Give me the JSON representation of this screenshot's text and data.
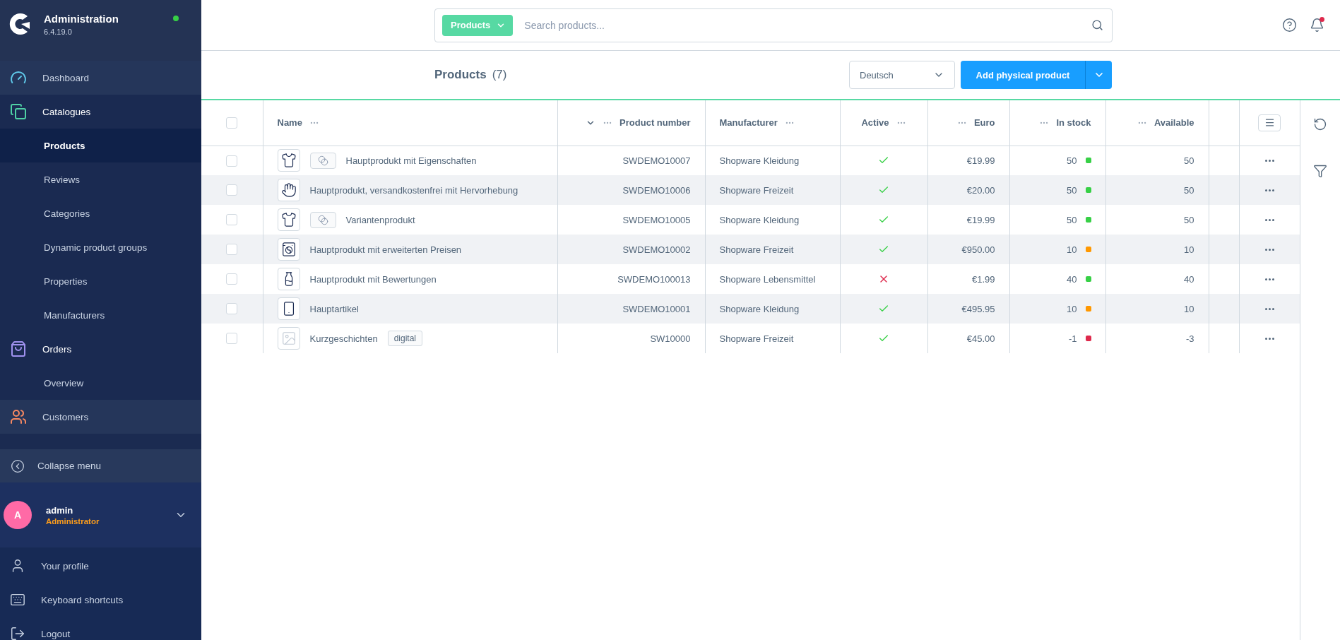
{
  "sidebar": {
    "app_title": "Administration",
    "version": "6.4.19.0",
    "online": true,
    "nav": [
      {
        "label": "Dashboard",
        "color": "#5fc8e8",
        "expanded": false
      },
      {
        "label": "Catalogues",
        "color": "#4fd1a5",
        "expanded": true,
        "children": [
          {
            "label": "Products",
            "selected": true
          },
          {
            "label": "Reviews",
            "selected": false
          },
          {
            "label": "Categories",
            "selected": false
          },
          {
            "label": "Dynamic product groups",
            "selected": false
          },
          {
            "label": "Properties",
            "selected": false
          },
          {
            "label": "Manufacturers",
            "selected": false
          }
        ]
      },
      {
        "label": "Orders",
        "color": "#a092f0",
        "expanded": true,
        "children": [
          {
            "label": "Overview",
            "selected": false
          }
        ]
      },
      {
        "label": "Customers",
        "color": "#f88962",
        "expanded": false
      }
    ],
    "collapse_label": "Collapse menu",
    "user": {
      "initials": "A",
      "name": "admin",
      "role": "Administrator"
    },
    "footer": [
      "Your profile",
      "Keyboard shortcuts",
      "Logout"
    ]
  },
  "topbar": {
    "search_type": "Products",
    "search_placeholder": "Search products...",
    "unread_notifications": true
  },
  "smartbar": {
    "title": "Products",
    "count": "(7)",
    "language": "Deutsch",
    "add_button": "Add physical product"
  },
  "table": {
    "all_selected": false,
    "columns": [
      {
        "label": "Name",
        "sorted": false
      },
      {
        "label": "Product number",
        "sorted": true
      },
      {
        "label": "Manufacturer",
        "sorted": false
      },
      {
        "label": "Active",
        "sorted": false
      },
      {
        "label": "Euro",
        "sorted": false
      },
      {
        "label": "In stock",
        "sorted": false
      },
      {
        "label": "Available",
        "sorted": false
      }
    ],
    "rows": [
      {
        "selected": false,
        "variants": true,
        "name": "Hauptprodukt mit Eigenschaften",
        "number": "SWDEMO10007",
        "manufacturer": "Shopware Kleidung",
        "active": true,
        "price": "€19.99",
        "stock": "50",
        "color": "#37d046",
        "available": "50"
      },
      {
        "selected": false,
        "variants": false,
        "name": "Hauptprodukt, versandkostenfrei mit Hervorhebung",
        "number": "SWDEMO10006",
        "manufacturer": "Shopware Freizeit",
        "active": true,
        "price": "€20.00",
        "stock": "50",
        "color": "#37d046",
        "available": "50"
      },
      {
        "selected": false,
        "variants": true,
        "name": "Variantenprodukt",
        "number": "SWDEMO10005",
        "manufacturer": "Shopware Kleidung",
        "active": true,
        "price": "€19.99",
        "stock": "50",
        "color": "#37d046",
        "available": "50"
      },
      {
        "selected": false,
        "variants": false,
        "name": "Hauptprodukt mit erweiterten Preisen",
        "number": "SWDEMO10002",
        "manufacturer": "Shopware Freizeit",
        "active": true,
        "price": "€950.00",
        "stock": "10",
        "color": "#ff9800",
        "available": "10"
      },
      {
        "selected": false,
        "variants": false,
        "name": "Hauptprodukt mit Bewertungen",
        "number": "SWDEMO100013",
        "manufacturer": "Shopware Lebensmittel",
        "active": false,
        "price": "€1.99",
        "stock": "40",
        "color": "#37d046",
        "available": "40"
      },
      {
        "selected": false,
        "variants": false,
        "name": "Hauptartikel",
        "number": "SWDEMO10001",
        "manufacturer": "Shopware Kleidung",
        "active": true,
        "price": "€495.95",
        "stock": "10",
        "color": "#ff9800",
        "available": "10"
      },
      {
        "selected": false,
        "variants": false,
        "name": "Kurzgeschichten",
        "tag": "digital",
        "number": "SW10000",
        "manufacturer": "Shopware Freizeit",
        "active": true,
        "price": "€45.00",
        "stock": "-1",
        "color": "#de294c",
        "available": "-3"
      }
    ]
  }
}
